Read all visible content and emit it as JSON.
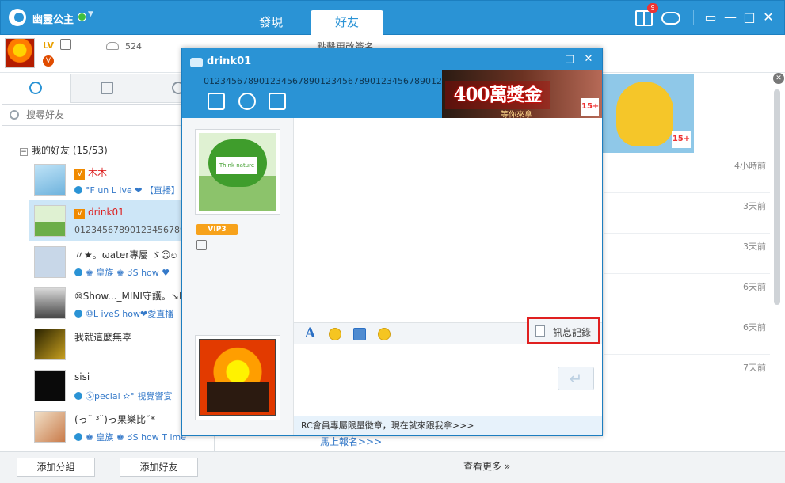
{
  "window": {
    "username": "幽靈公主",
    "tabs": [
      "發現",
      "好友"
    ],
    "active_tab": "好友",
    "gift_badge": "9",
    "controls": [
      "▭",
      "—",
      "□",
      "✕"
    ]
  },
  "profile": {
    "level": "LV",
    "vip": "V",
    "points": "524",
    "signature": "點擊更改簽名"
  },
  "left_panel": {
    "search_placeholder": "搜尋好友",
    "group": {
      "label": "我的好友",
      "count": "(15/53)",
      "toggle": "−"
    },
    "friends": [
      {
        "name": "木木",
        "sub": "°F un L ive ❤ 【直播】",
        "vip": true
      },
      {
        "name": "drink01",
        "sub": "0123456789012345678901234567890",
        "vip": true,
        "selected": true
      },
      {
        "name": "〃★。ωater專屬 ゞ☺ಲ",
        "sub": "♚ 皇族 ♚ ☌S how ♥",
        "vip": false
      },
      {
        "name": "⑩Show..._MINI守護。↘ICE",
        "sub": "⑩L iveS how❤愛直播",
        "vip": false
      },
      {
        "name": "我就這麼無辜",
        "sub": "",
        "vip": false
      },
      {
        "name": "sisi",
        "sub": "Ⓢpecial ✫° 視覺響宴",
        "vip": false
      },
      {
        "name": "(っ˘ ³˘)っ果樂比ˇ*",
        "sub": "♚ 皇族 ♚ ☌S how T ime",
        "vip": false
      }
    ],
    "add_group": "添加分組",
    "add_friend": "添加好友"
  },
  "right_panel": {
    "times": [
      "4小時前",
      "3天前",
      "3天前",
      "6天前",
      "6天前",
      "7天前"
    ],
    "see_more": "查看更多",
    "signup_link": "馬上報名>>>",
    "ad_rating": "15+"
  },
  "chat": {
    "title": "drink01",
    "signature": "0123456789012345678901234567890123456789012345678901",
    "banner_text": "400萬獎金",
    "banner_sub": "等你來拿",
    "banner_rating": "15+",
    "vip_level": "VIP3",
    "avatar_text": "Think nature",
    "history_label": "訊息記錄",
    "send_icon": "↵",
    "footer_promo": "RC會員專屬限量徽章，現在就來跟我拿>>>",
    "controls": [
      "—",
      "□",
      "✕"
    ],
    "font_icon": "A"
  },
  "icons": {
    "accent": "#2a93d5",
    "highlight": "#e02020"
  }
}
